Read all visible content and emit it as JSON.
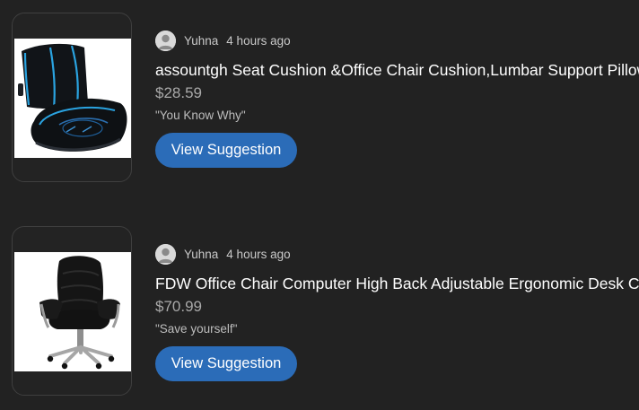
{
  "suggestions": [
    {
      "username": "Yuhna",
      "time": "4 hours ago",
      "title": "assountgh Seat Cushion &Office Chair Cushion,Lumbar Support Pillow for Office Chair",
      "price": "$28.59",
      "quote": "\"You Know Why\"",
      "button_label": "View Suggestion",
      "image": "seat-cushion-lumbar-pillow-image"
    },
    {
      "username": "Yuhna",
      "time": "4 hours ago",
      "title": "FDW Office Chair Computer High Back Adjustable Ergonomic Desk Chair",
      "price": "$70.99",
      "quote": "\"Save yourself\"",
      "button_label": "View Suggestion",
      "image": "office-chair-image"
    }
  ],
  "colors": {
    "background": "#222222",
    "button": "#2b6cb8",
    "price": "#a9a9a9",
    "meta_text": "#c9c9c9"
  }
}
